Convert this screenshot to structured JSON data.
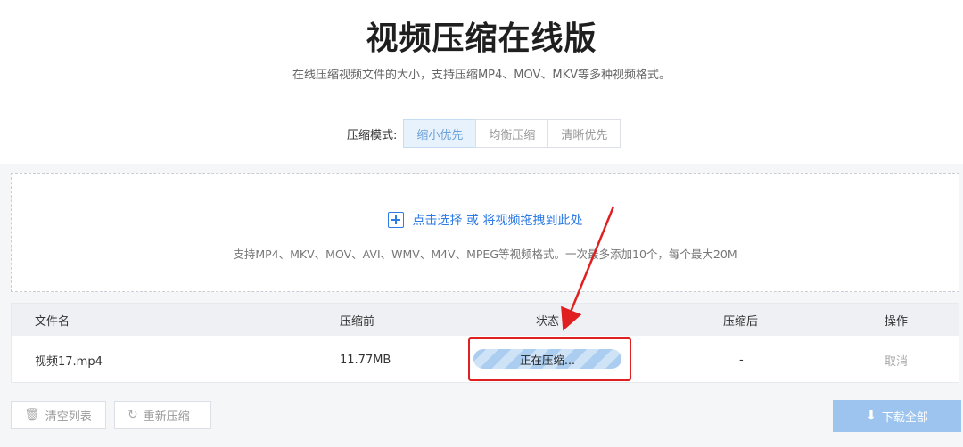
{
  "header": {
    "title": "视频压缩在线版",
    "subtitle": "在线压缩视频文件的大小，支持压缩MP4、MOV、MKV等多种视频格式。"
  },
  "mode": {
    "label": "压缩模式:",
    "options": [
      "缩小优先",
      "均衡压缩",
      "清晰优先"
    ],
    "selected": "缩小优先"
  },
  "dropzone": {
    "main_text": "点击选择 或 将视频拖拽到此处",
    "hint": "支持MP4、MKV、MOV、AVI、WMV、M4V、MPEG等视频格式。一次最多添加10个，每个最大20M"
  },
  "table": {
    "headers": [
      "文件名",
      "压缩前",
      "状态",
      "压缩后",
      "操作"
    ],
    "rows": [
      {
        "filename": "视频17.mp4",
        "size_before": "11.77MB",
        "status": "正在压缩...",
        "progress": 0.0,
        "size_after": "-",
        "action": "取消"
      }
    ]
  },
  "buttons": {
    "clear": "清空列表",
    "recompress": "重新压缩",
    "download_all": "下载全部"
  },
  "colors": {
    "accent": "#2d7be5",
    "annotation": "#e02020",
    "download_button": "#9cc4ee"
  },
  "icons": [
    "plus-icon",
    "trash-icon",
    "refresh-icon",
    "download-icon"
  ]
}
